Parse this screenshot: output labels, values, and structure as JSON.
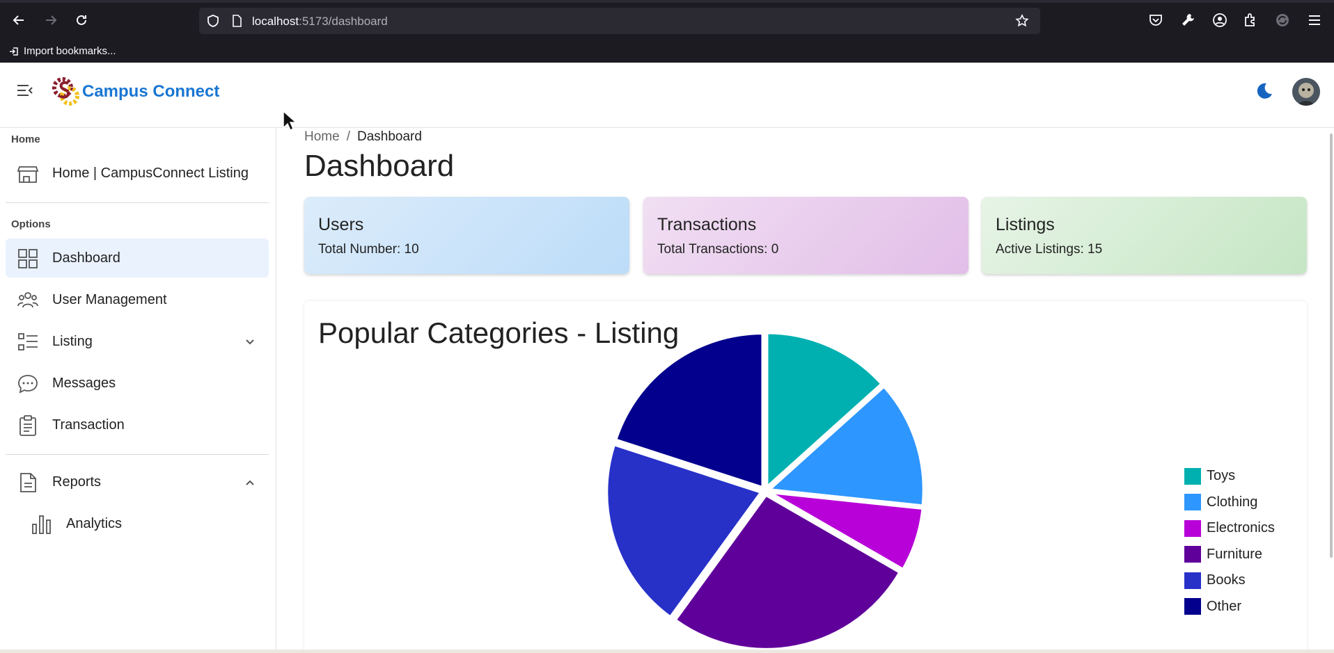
{
  "browser": {
    "url_host": "localhost",
    "url_path": ":5173/dashboard",
    "bookmark_label": "Import bookmarks..."
  },
  "header": {
    "brand": "Campus Connect"
  },
  "sidebar": {
    "section_home": "Home",
    "home_item": "Home | CampusConnect Listing",
    "section_options": "Options",
    "items": [
      {
        "label": "Dashboard"
      },
      {
        "label": "User Management"
      },
      {
        "label": "Listing"
      },
      {
        "label": "Messages"
      },
      {
        "label": "Transaction"
      }
    ],
    "reports": "Reports",
    "analytics": "Analytics"
  },
  "breadcrumb": {
    "home": "Home",
    "separator": "/",
    "current": "Dashboard"
  },
  "page_title": "Dashboard",
  "cards": {
    "users": {
      "title": "Users",
      "subtitle": "Total Number: 10"
    },
    "transactions": {
      "title": "Transactions",
      "subtitle": "Total Transactions: 0"
    },
    "listings": {
      "title": "Listings",
      "subtitle": "Active Listings: 15"
    }
  },
  "chart_title": "Popular Categories - Listing",
  "chart_data": {
    "type": "pie",
    "title": "Popular Categories - Listing",
    "categories": [
      "Toys",
      "Clothing",
      "Electronics",
      "Furniture",
      "Books",
      "Other"
    ],
    "values": [
      2,
      2,
      1,
      4,
      3,
      3
    ],
    "colors": [
      "#00b0b0",
      "#2e96ff",
      "#b800d8",
      "#60009b",
      "#2731c8",
      "#02008d"
    ],
    "legend": "right"
  }
}
